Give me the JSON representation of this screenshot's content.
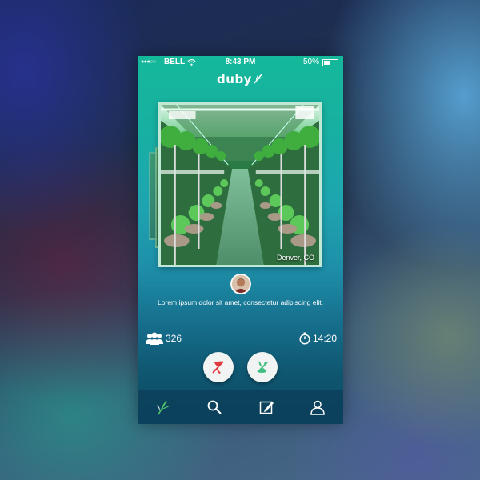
{
  "status_bar": {
    "signal": "●●●○○",
    "carrier": "BELL",
    "time": "8:43 PM",
    "battery": "50%",
    "battery_level": 0.5
  },
  "app": {
    "logo_text": "duby"
  },
  "card": {
    "location": "Denver, CO"
  },
  "post": {
    "description": "Lorem ipsum dolor sit amet, consectetur adipiscing elit."
  },
  "stats": {
    "followers": "326",
    "timer": "14:20"
  },
  "actions": {
    "down_color": "#e0393e",
    "up_color": "#3fbf7f"
  },
  "tabs": [
    {
      "icon": "leaf-icon",
      "active": true
    },
    {
      "icon": "search-icon",
      "active": false
    },
    {
      "icon": "compose-icon",
      "active": false
    },
    {
      "icon": "profile-icon",
      "active": false
    }
  ],
  "colors": {
    "accent": "#18b39c",
    "tab_bar": "#0c405a"
  }
}
